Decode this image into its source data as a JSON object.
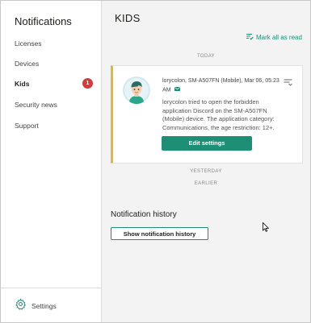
{
  "sidebar": {
    "title": "Notifications",
    "items": [
      {
        "label": "Licenses"
      },
      {
        "label": "Devices"
      },
      {
        "label": "Kids",
        "badge": "1",
        "active": true
      },
      {
        "label": "Security news"
      },
      {
        "label": "Support"
      }
    ],
    "settings_label": "Settings"
  },
  "main": {
    "title": "KIDS",
    "mark_all_read": "Mark all as read",
    "sections": {
      "today": "TODAY",
      "yesterday": "YESTERDAY",
      "earlier": "EARLIER"
    },
    "notification": {
      "header": "lorycolon, SM-A507FN (Mobile), Mar 06, 05:23 AM",
      "body": "lorycolon tried to open the forbidden application Discord on the SM-A507FN (Mobile) device. The application category: Communications, the age restriction: 12+.",
      "button": "Edit settings",
      "accent_color": "#e8b730"
    },
    "history": {
      "title": "Notification history",
      "button": "Show notification history"
    }
  },
  "colors": {
    "brand": "#1d8f74",
    "badge": "#d33a3a"
  },
  "icons": [
    "gear-icon",
    "mark-read-icon",
    "mail-icon",
    "more-icon",
    "avatar-icon",
    "mouse-cursor-icon"
  ]
}
